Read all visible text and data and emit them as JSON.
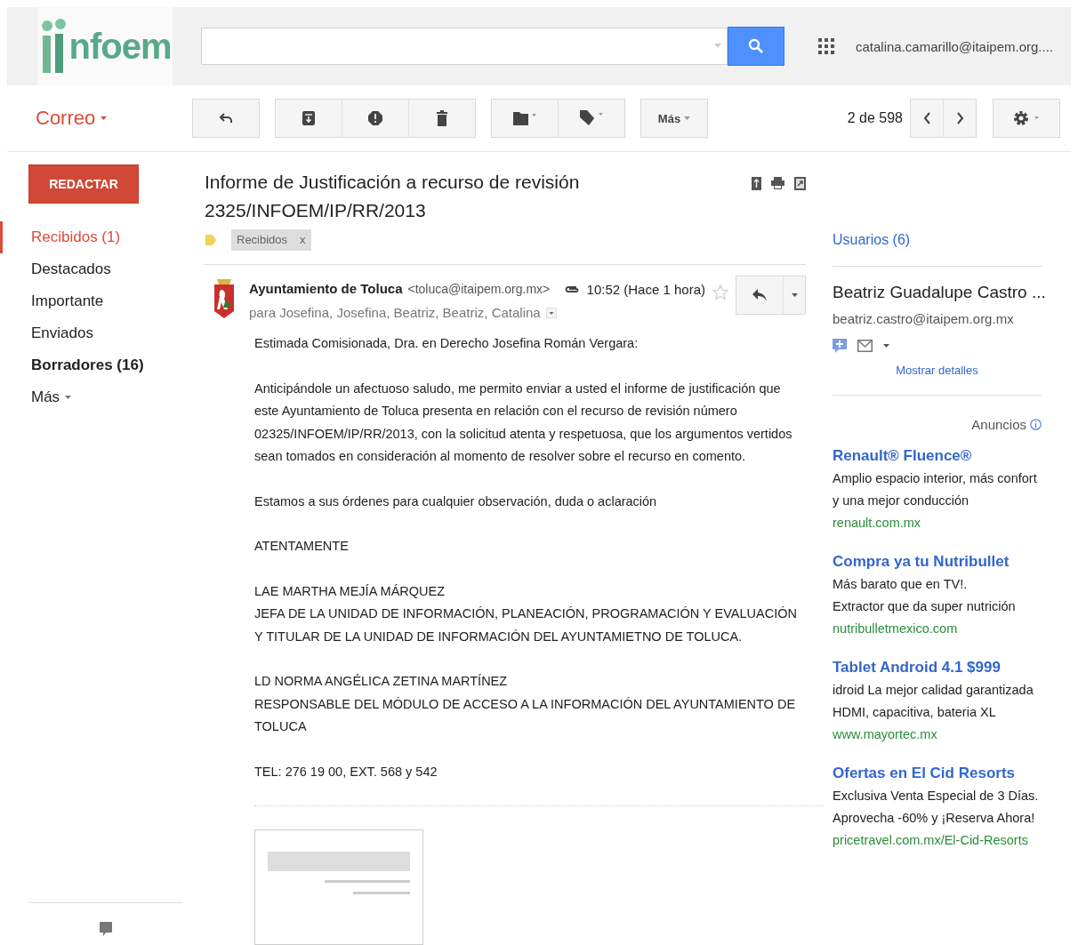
{
  "header": {
    "logo_text": "nfoem",
    "account": "catalina.camarillo@itaipem.org...."
  },
  "toolbar": {
    "app_menu": "Correo",
    "groups": [
      [
        {
          "kind": "reply"
        }
      ],
      [
        {
          "kind": "archive"
        },
        {
          "kind": "spam"
        },
        {
          "kind": "delete"
        }
      ],
      [
        {
          "kind": "folder"
        },
        {
          "kind": "label"
        }
      ],
      [
        {
          "kind": "more",
          "label": "Más"
        }
      ]
    ],
    "pagination": "2 de 598"
  },
  "sidebar": {
    "compose": "REDACTAR",
    "items": [
      {
        "label": "Recibidos (1)",
        "selected": true,
        "bold": false
      },
      {
        "label": "Destacados",
        "selected": false,
        "bold": false
      },
      {
        "label": "Importante",
        "selected": false,
        "bold": false
      },
      {
        "label": "Enviados",
        "selected": false,
        "bold": false
      },
      {
        "label": "Borradores (16)",
        "selected": false,
        "bold": true
      }
    ],
    "more": "Más"
  },
  "message": {
    "subject": "Informe de Justificación a recurso de revisión 2325/INFOEM/IP/RR/2013",
    "label_chip": "Recibidos",
    "chip_remove": "x",
    "sender_name": "Ayuntamiento de Toluca",
    "sender_email": "<toluca@itaipem.org.mx>",
    "recipients": "para Josefina, Josefina, Beatriz, Beatriz, Catalina",
    "time": "10:52 (Hace 1 hora)",
    "starred": false,
    "body": [
      {
        "lines": [
          "Estimada Comisionada, Dra. en Derecho Josefina Román Vergara:"
        ]
      },
      {
        "lines": [
          "Anticipándole un afectuoso saludo, me permito enviar a usted el informe de justificación que este Ayuntamiento de Toluca presenta en relación con el recurso de revisión número 02325/INFOEM/IP/RR/2013, con la solicitud atenta y respetuosa, que los argumentos vertidos sean tomados en consideración al momento de resolver sobre el recurso en comento."
        ]
      },
      {
        "lines": [
          "Estamos a sus órdenes para cualquier observación, duda o aclaración"
        ]
      },
      {
        "lines": [
          "ATENTAMENTE"
        ]
      },
      {
        "lines": [
          "LAE MARTHA MEJÍA MÁRQUEZ",
          "JEFA DE LA UNIDAD DE INFORMACIÓN, PLANEACIÓN, PROGRAMACIÓN Y EVALUACIÓN Y TITULAR DE LA UNIDAD DE INFORMACIÓN DEL AYUNTAMIETNO DE TOLUCA."
        ]
      },
      {
        "lines": [
          "LD NORMA ANGÉLICA ZETINA MARTÍNEZ",
          "RESPONSABLE DEL MÓDULO DE ACCESO A LA INFORMACIÓN DEL AYUNTAMIENTO DE TOLUCA"
        ]
      },
      {
        "lines": [
          "TEL: 276 19 00, EXT. 568 y 542"
        ]
      }
    ]
  },
  "people": {
    "header": "Usuarios (6)",
    "contact_name": "Beatriz Guadalupe Castro ...",
    "contact_email": "beatriz.castro@itaipem.org.mx",
    "details_link": "Mostrar detalles"
  },
  "ads": {
    "header": "Anuncios",
    "items": [
      {
        "title": "Renault® Fluence®",
        "lines": [
          "Amplio espacio interior, más confort y una mejor conducción"
        ],
        "url": "renault.com.mx"
      },
      {
        "title": "Compra ya tu Nutribullet",
        "lines": [
          "Más barato que en TV!.",
          "Extractor que da super nutrición"
        ],
        "url": "nutribulletmexico.com"
      },
      {
        "title": "Tablet Android 4.1 $999",
        "lines": [
          "idroid La mejor calidad garantizada",
          "HDMI, capacitiva, bateria XL"
        ],
        "url": "www.mayortec.mx"
      },
      {
        "title": "Ofertas en El Cid Resorts",
        "lines": [
          "Exclusiva Venta Especial de 3 Días. Aprovecha -60% y ¡Reserva Ahora!"
        ],
        "url": "pricetravel.com.mx/El-Cid-Resorts"
      }
    ]
  }
}
